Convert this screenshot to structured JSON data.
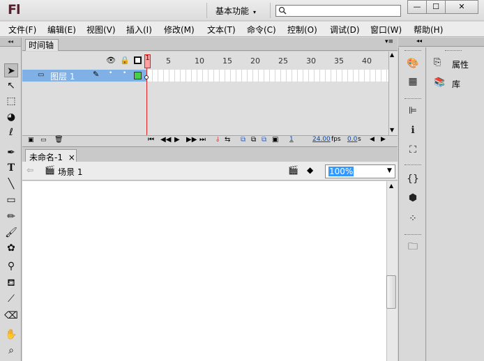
{
  "app": {
    "logo": "Fl",
    "workspace": "基本功能",
    "workspace_arrow": "▾"
  },
  "window": {
    "min": "—",
    "max": "☐",
    "close": "✕"
  },
  "menu": [
    "文件(F)",
    "编辑(E)",
    "视图(V)",
    "插入(I)",
    "修改(M)",
    "文本(T)",
    "命令(C)",
    "控制(O)",
    "调试(D)",
    "窗口(W)",
    "帮助(H)"
  ],
  "toolbar": {
    "grip": "◂◂"
  },
  "timeline": {
    "tab": "时间轴",
    "ruler": [
      "1",
      "5",
      "10",
      "15",
      "20",
      "25",
      "30",
      "35",
      "40"
    ],
    "layer_name": "图层 1",
    "fps": "24.00",
    "fps_unit": "fps",
    "time": "0.0",
    "time_unit": "s",
    "current_frame": "1"
  },
  "document": {
    "tab": "未命名-1",
    "tab_close": "×",
    "scene": "场景 1",
    "zoom": "100%"
  },
  "right_panel": {
    "grip": "◂◂",
    "items": [
      {
        "label": "属性"
      },
      {
        "label": "库"
      }
    ]
  }
}
